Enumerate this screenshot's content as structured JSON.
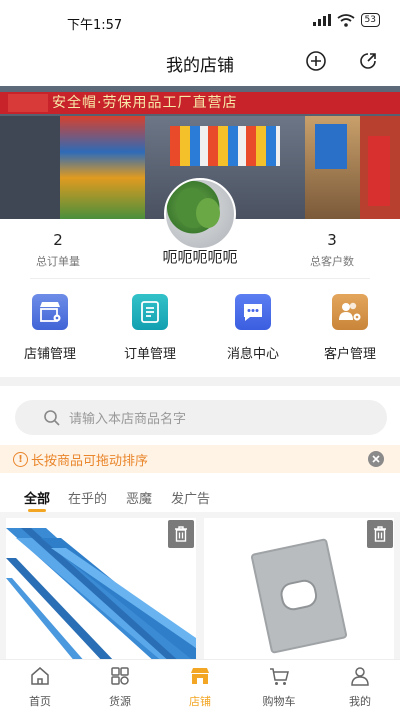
{
  "status_bar": {
    "time": "下午1:57",
    "battery": "53"
  },
  "header": {
    "title": "我的店铺"
  },
  "store": {
    "name": "呃呃呃呃呃",
    "banner_sign": "安全帽·劳保用品工厂直营店"
  },
  "stats": [
    {
      "value": "2",
      "label": "总订单量"
    },
    {
      "value": "3",
      "label": "总客户数"
    }
  ],
  "menu": [
    {
      "label": "店铺管理",
      "icon": "store-settings-icon",
      "color": "#4a6ee0"
    },
    {
      "label": "订单管理",
      "icon": "order-list-icon",
      "color": "#1aa8b8"
    },
    {
      "label": "消息中心",
      "icon": "message-icon",
      "color": "#4466e8"
    },
    {
      "label": "客户管理",
      "icon": "customer-settings-icon",
      "color": "#d4934a"
    }
  ],
  "search": {
    "placeholder": "请输入本店商品名字"
  },
  "notice": {
    "text": "长按商品可拖动排序"
  },
  "tabs": [
    {
      "label": "全部",
      "active": true
    },
    {
      "label": "在乎的",
      "active": false
    },
    {
      "label": "恶魔",
      "active": false
    },
    {
      "label": "发广告",
      "active": false
    }
  ],
  "products": [
    {
      "image": "blue-guardrail-steel-photo"
    },
    {
      "image": "metal-plate-photo"
    }
  ],
  "bottom_nav": [
    {
      "label": "首页",
      "icon": "home-icon",
      "active": false
    },
    {
      "label": "货源",
      "icon": "grid-icon",
      "active": false
    },
    {
      "label": "店铺",
      "icon": "store-icon",
      "active": true
    },
    {
      "label": "购物车",
      "icon": "cart-icon",
      "active": false
    },
    {
      "label": "我的",
      "icon": "user-icon",
      "active": false
    }
  ],
  "colors": {
    "accent": "#f2a623",
    "notice_bg": "#fff3e6",
    "notice_text": "#e9862b"
  }
}
